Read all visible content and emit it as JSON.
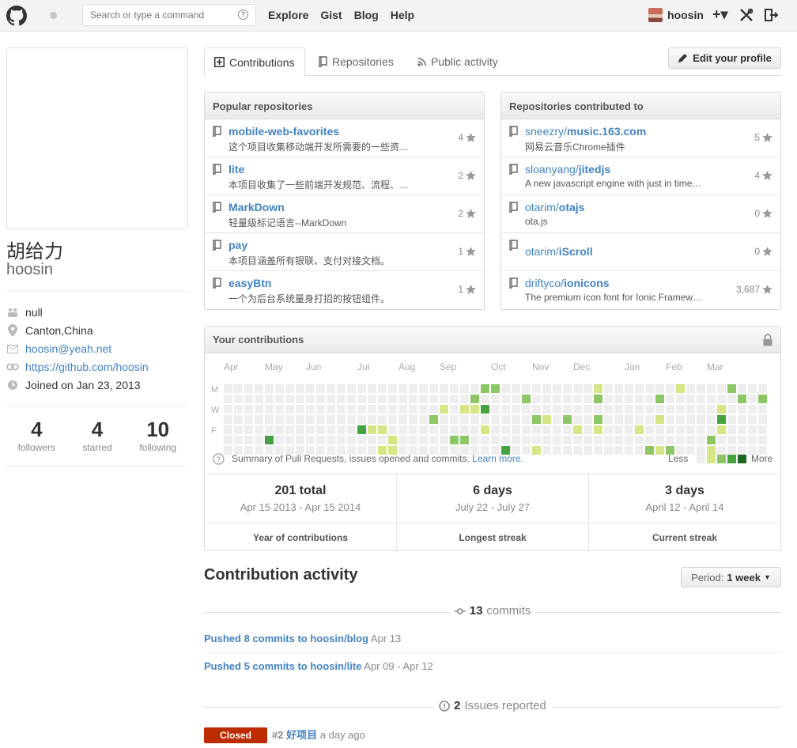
{
  "header": {
    "search_placeholder": "Search or type a command",
    "search_help": "?",
    "nav": [
      "Explore",
      "Gist",
      "Blog",
      "Help"
    ],
    "user": "hoosin",
    "plus": "+▾"
  },
  "profile": {
    "fullname": "胡给力",
    "username": "hoosin",
    "details": [
      {
        "icon": "organization-icon",
        "text": "null",
        "link": false
      },
      {
        "icon": "location-icon",
        "text": "Canton,China",
        "link": false
      },
      {
        "icon": "mail-icon",
        "text": "hoosin@yeah.net",
        "link": true
      },
      {
        "icon": "link-icon",
        "text": "https://github.com/hoosin",
        "link": true
      },
      {
        "icon": "clock-icon",
        "text": "Joined on Jan 23, 2013",
        "link": false
      }
    ],
    "stats": [
      {
        "num": "4",
        "label": "followers"
      },
      {
        "num": "4",
        "label": "starred"
      },
      {
        "num": "10",
        "label": "following"
      }
    ]
  },
  "tabs": [
    "Contributions",
    "Repositories",
    "Public activity"
  ],
  "edit_profile": "Edit your profile",
  "popular": {
    "title": "Popular repositories",
    "repos": [
      {
        "name": "mobile-web-favorites",
        "desc": "这个项目收集移动端开发所需要的一些资…",
        "stars": "4"
      },
      {
        "name": "lite",
        "desc": "本项目收集了一些前端开发规范、流程、…",
        "stars": "2"
      },
      {
        "name": "MarkDown",
        "desc": "轻量级标记语言--MarkDown",
        "stars": "2"
      },
      {
        "name": "pay",
        "desc": "本项目涵盖所有银联、支付对接文档。",
        "stars": "1"
      },
      {
        "name": "easyBtn",
        "desc": "一个为后台系统量身打招的按钮组件。",
        "stars": "1"
      }
    ]
  },
  "contributed": {
    "title": "Repositories contributed to",
    "repos": [
      {
        "owner": "sneezry/",
        "name": "music.163.com",
        "desc": "网易云音乐Chrome插件",
        "stars": "5"
      },
      {
        "owner": "sloanyang/",
        "name": "jitedjs",
        "desc": "A new javascript engine with just in time…",
        "stars": "4"
      },
      {
        "owner": "otarim/",
        "name": "otajs",
        "desc": "ota.js",
        "stars": "0"
      },
      {
        "owner": "otarim/",
        "name": "iScroll",
        "desc": "",
        "stars": "0"
      },
      {
        "owner": "driftyco/",
        "name": "ionicons",
        "desc": "The premium icon font for Ionic Framew…",
        "stars": "3,687"
      }
    ]
  },
  "contributions": {
    "title": "Your contributions",
    "months": [
      "Apr",
      "May",
      "Jun",
      "Jul",
      "Aug",
      "Sep",
      "Oct",
      "Nov",
      "Dec",
      "Jan",
      "Feb",
      "Mar"
    ],
    "days": [
      "M",
      "W",
      "F"
    ],
    "summary": "Summary of Pull Requests, issues opened and commits.",
    "learn_more": "Learn more.",
    "less": "Less",
    "more": "More",
    "colors": [
      "#eeeeee",
      "#d6e685",
      "#8cc665",
      "#44a340",
      "#1e6823"
    ],
    "stats": [
      {
        "big": "201 total",
        "sub": "Apr 15 2013 - Apr 15 2014",
        "foot": "Year of contributions"
      },
      {
        "big": "6 days",
        "sub": "July 22 - July 27",
        "foot": "Longest streak"
      },
      {
        "big": "3 days",
        "sub": "April 12 - April 14",
        "foot": "Current streak"
      }
    ]
  },
  "activity": {
    "title": "Contribution activity",
    "period_label": "Period:",
    "period_value": "1 week",
    "commits_count": "13",
    "commits_label": "commits",
    "pushes": [
      {
        "text": "Pushed 8 commits to hoosin/blog",
        "date": "Apr 13"
      },
      {
        "text": "Pushed 5 commits to hoosin/lite",
        "date": "Apr 09 - Apr 12"
      }
    ],
    "issues_count": "2",
    "issues_label": "Issues reported",
    "issue": {
      "state": "Closed",
      "number": "#2",
      "title": "好项目",
      "date": "a day ago"
    }
  }
}
